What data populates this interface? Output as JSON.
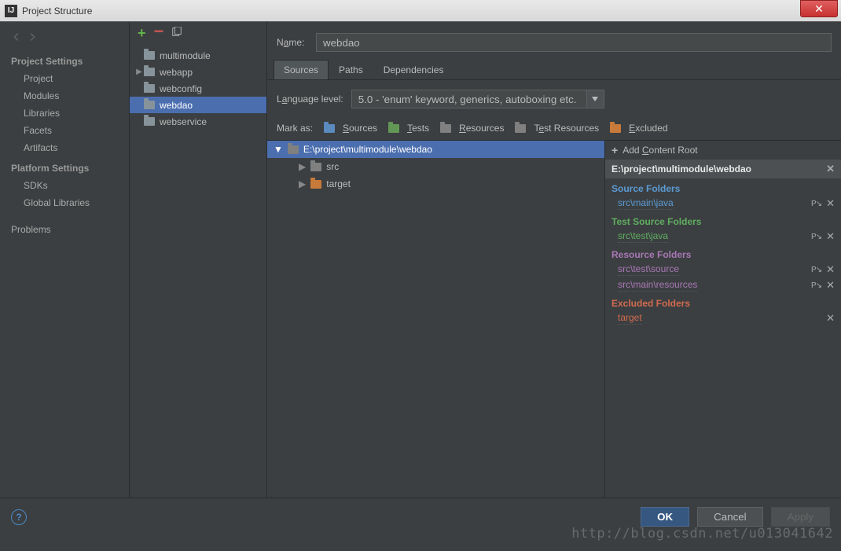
{
  "window": {
    "title": "Project Structure"
  },
  "sidebar": {
    "heading1": "Project Settings",
    "items1": [
      "Project",
      "Modules",
      "Libraries",
      "Facets",
      "Artifacts"
    ],
    "heading2": "Platform Settings",
    "items2": [
      "SDKs",
      "Global Libraries"
    ],
    "problems": "Problems"
  },
  "modules": {
    "items": [
      {
        "label": "multimodule"
      },
      {
        "label": "webapp",
        "expandable": true
      },
      {
        "label": "webconfig"
      },
      {
        "label": "webdao",
        "selected": true
      },
      {
        "label": "webservice"
      }
    ]
  },
  "name": {
    "label_pre": "N",
    "label_ul": "a",
    "label_post": "me:",
    "value": "webdao"
  },
  "tabs": [
    {
      "label": "Sources",
      "active": true
    },
    {
      "label": "Paths"
    },
    {
      "label": "Dependencies"
    }
  ],
  "lang": {
    "label_pre": "L",
    "label_ul": "a",
    "label_post": "nguage level:",
    "value": "5.0 - 'enum' keyword, generics, autoboxing etc."
  },
  "mark": {
    "label": "Mark as:",
    "items": [
      {
        "label": "Sources",
        "ul": "S",
        "rest": "ources",
        "color": "blue"
      },
      {
        "label": "Tests",
        "ul": "T",
        "rest": "ests",
        "color": "green"
      },
      {
        "label": "Resources",
        "ul": "R",
        "rest": "esources",
        "color": "grey"
      },
      {
        "label": "Test Resources",
        "text": "T",
        "ul": "e",
        "rest": "st Resources",
        "color": "grey"
      },
      {
        "label": "Excluded",
        "ul": "E",
        "rest": "xcluded",
        "color": "orange"
      }
    ]
  },
  "contentRoot": {
    "path": "E:\\project\\multimodule\\webdao",
    "children": [
      {
        "label": "src",
        "color": "grey"
      },
      {
        "label": "target",
        "color": "orange"
      }
    ]
  },
  "right": {
    "add": "Add ",
    "add_ul": "C",
    "add_post": "ontent Root",
    "root": "E:\\project\\multimodule\\webdao",
    "sections": [
      {
        "title": "Source Folders",
        "cls": "sf",
        "items": [
          {
            "path": "src\\main\\java",
            "p": true
          }
        ]
      },
      {
        "title": "Test Source Folders",
        "cls": "tf",
        "items": [
          {
            "path": "src\\test\\java",
            "p": true
          }
        ]
      },
      {
        "title": "Resource Folders",
        "cls": "rf",
        "items": [
          {
            "path": "src\\test\\source",
            "p": true
          },
          {
            "path": "src\\main\\resources",
            "p": true
          }
        ]
      },
      {
        "title": "Excluded Folders",
        "cls": "ef",
        "items": [
          {
            "path": "target"
          }
        ]
      }
    ]
  },
  "footer": {
    "ok": "OK",
    "cancel": "Cancel",
    "apply": "Apply"
  },
  "watermark": "http://blog.csdn.net/u013041642"
}
